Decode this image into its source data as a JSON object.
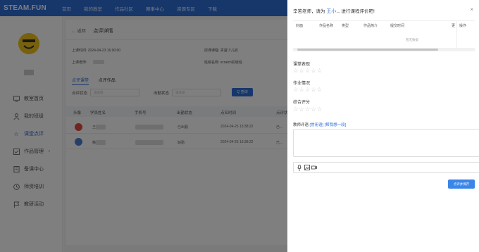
{
  "brand": "STEAM.FUN",
  "nav": [
    "首页",
    "我的教室",
    "作品社区",
    "赛事中心",
    "资源专区",
    "下载"
  ],
  "sidebar": [
    {
      "label": "教室首页",
      "icon": "monitor-icon"
    },
    {
      "label": "我的班级",
      "icon": "user-icon"
    },
    {
      "label": "课堂点评",
      "icon": "star-icon",
      "active": true
    },
    {
      "label": "作品管理",
      "icon": "checkbox-icon"
    },
    {
      "label": "备课中心",
      "icon": "book-icon"
    },
    {
      "label": "师资培训",
      "icon": "clock-icon"
    },
    {
      "label": "教研活动",
      "icon": "flag-icon"
    }
  ],
  "page": {
    "back": "← 返回",
    "title": "点评详情",
    "info": {
      "time": "上课时间: 2024-04-23 16:00:00",
      "course": "授课课程: 青苗少儿初",
      "teacher": "上课老师:",
      "class": "班级名称: scratch初级班"
    },
    "tabs": [
      "点评课堂",
      "点评作品"
    ],
    "filters": [
      {
        "label": "点评状态",
        "placeholder": "请选择"
      },
      {
        "label": "出勤状态",
        "placeholder": "请选择"
      }
    ],
    "query": "Q 查询",
    "columns": [
      "头像",
      "学员姓名",
      "手机号",
      "出勤状态",
      "点名时间",
      "点评状"
    ],
    "rows": [
      {
        "name": "王",
        "attendance": "已出勤",
        "time": "2024-04-25 13:38:22",
        "status": "已..."
      },
      {
        "name": "韩",
        "attendance": "缺勤",
        "time": "2024-04-25 13:38:22",
        "status": "已..."
      }
    ]
  },
  "drawer": {
    "title_pre": "辛苦老师，请为 ",
    "student": "王小",
    "title_post": "... 进行课程评价吧!",
    "close": "×",
    "work_columns": [
      "封面",
      "作品名称",
      "类型",
      "作品简介",
      "提交时间",
      "更",
      "操作"
    ],
    "empty": "暂无数据",
    "sections": [
      "课堂表现",
      "作业情况",
      "综合评分"
    ],
    "stars": "☆☆☆☆☆",
    "comment_label": "教师评语",
    "common_phrase": "[常用语]",
    "help_phrase": "[帮我想一段]",
    "save": "点评并保存"
  }
}
